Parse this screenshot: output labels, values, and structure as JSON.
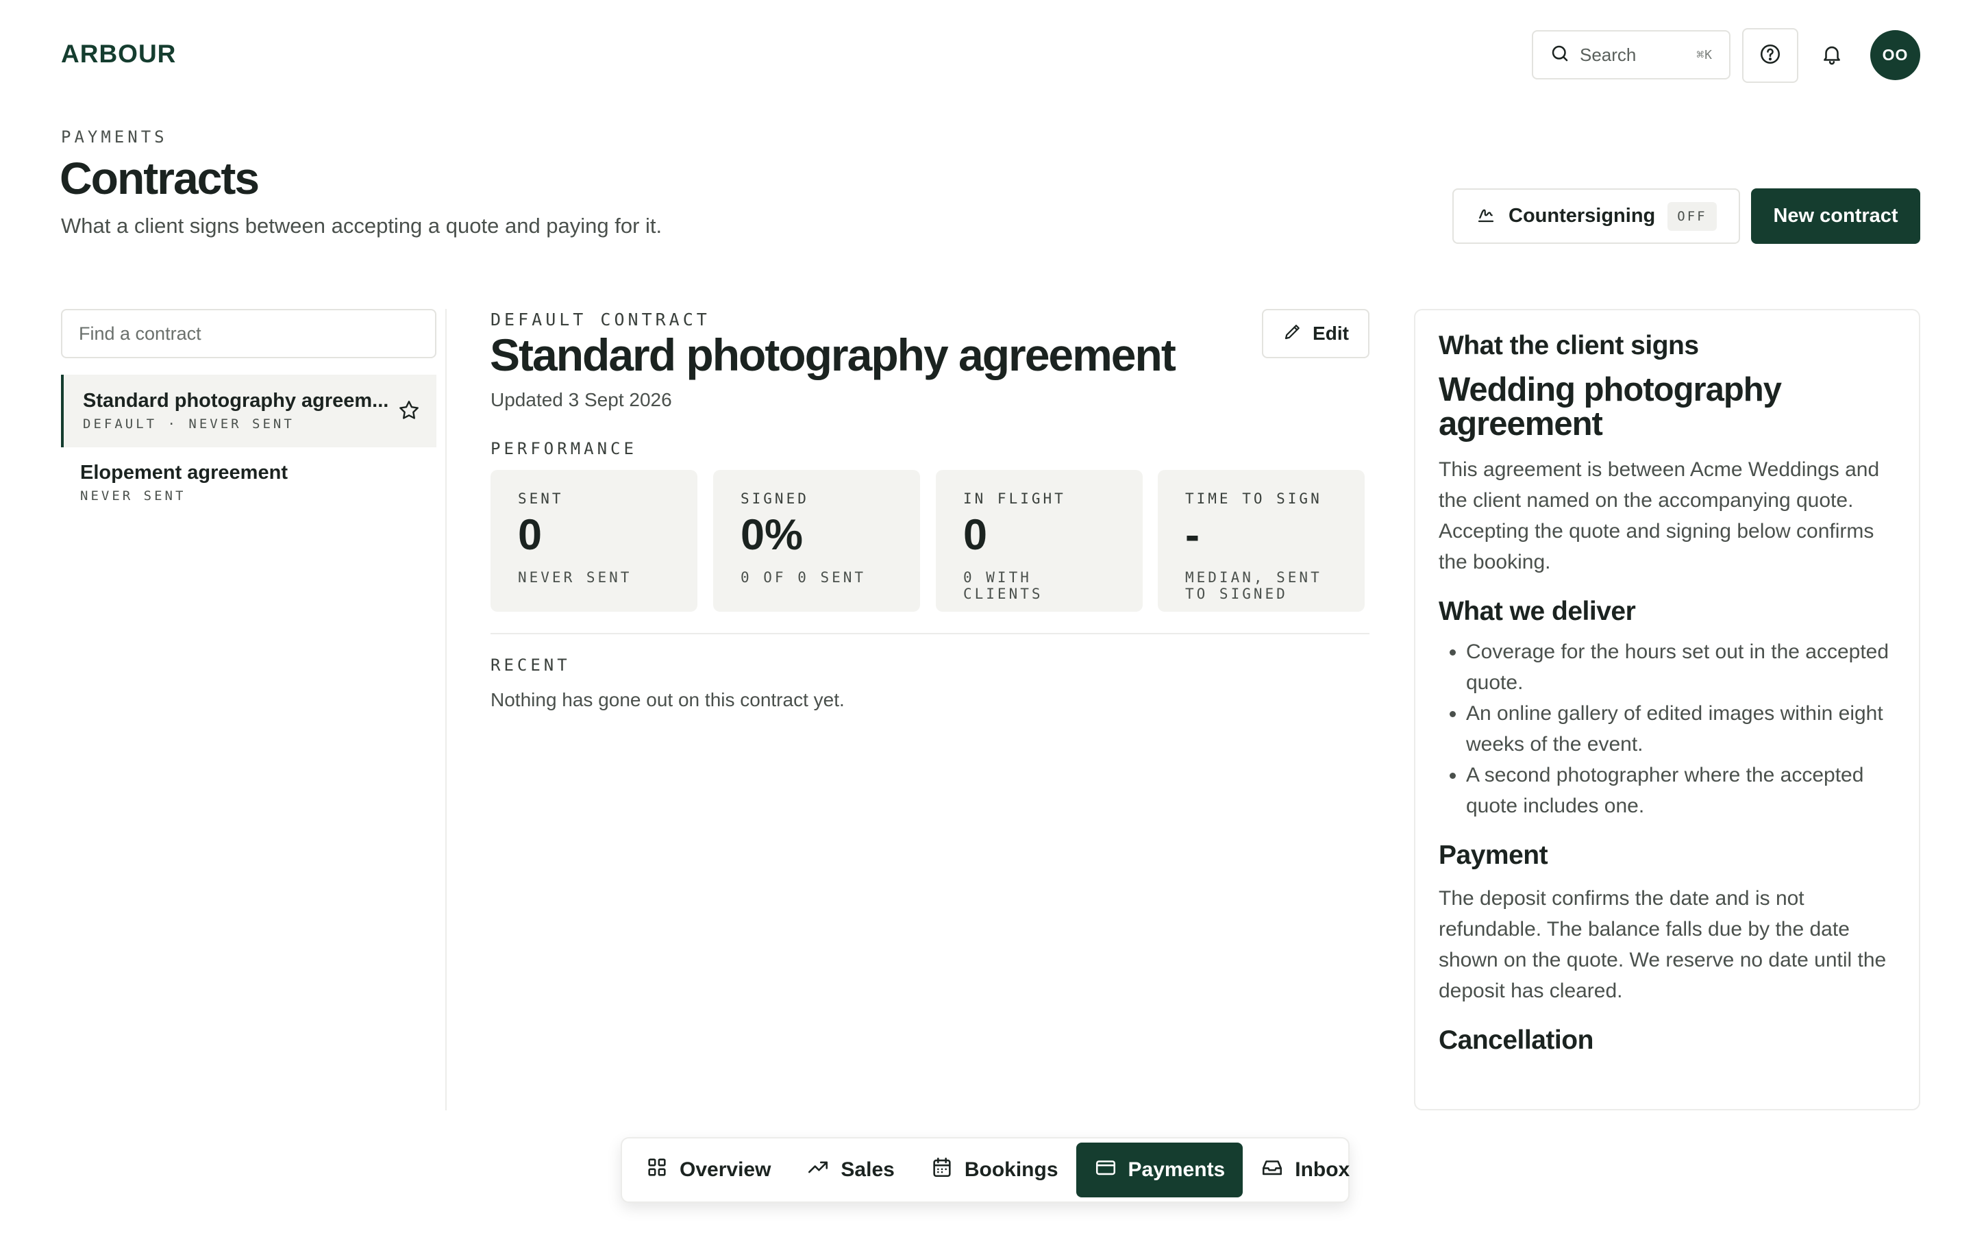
{
  "app": {
    "logo": "ARBOUR"
  },
  "topbar": {
    "search_label": "Search",
    "search_shortcut": "⌘K",
    "avatar_initials": "OO"
  },
  "page": {
    "eyebrow": "PAYMENTS",
    "title": "Contracts",
    "subtitle": "What a client signs between accepting a quote and paying for it.",
    "countersigning_label": "Countersigning",
    "countersigning_state": "OFF",
    "new_contract_label": "New contract"
  },
  "sidebar": {
    "find_placeholder": "Find a contract",
    "items": [
      {
        "title": "Standard photography agreem...",
        "meta": "DEFAULT · NEVER SENT",
        "active": true
      },
      {
        "title": "Elopement agreement",
        "meta": "NEVER SENT",
        "active": false
      }
    ]
  },
  "contract": {
    "eyebrow": "DEFAULT CONTRACT",
    "title": "Standard photography agreement",
    "updated": "Updated 3 Sept 2026",
    "edit_label": "Edit",
    "performance_label": "PERFORMANCE",
    "stats": [
      {
        "label": "SENT",
        "value": "0",
        "sub": "NEVER SENT"
      },
      {
        "label": "SIGNED",
        "value": "0%",
        "sub": "0 OF 0 SENT"
      },
      {
        "label": "IN FLIGHT",
        "value": "0",
        "sub": "0 WITH CLIENTS"
      },
      {
        "label": "TIME TO SIGN",
        "value": "-",
        "sub": "MEDIAN, SENT TO SIGNED"
      }
    ],
    "recent_label": "RECENT",
    "recent_empty": "Nothing has gone out on this contract yet."
  },
  "preview": {
    "heading": "What the client signs",
    "doc_title": "Wedding photography agreement",
    "intro": "This agreement is between Acme Weddings and the client named on the accompanying quote. Accepting the quote and signing below confirms the booking.",
    "deliver_heading": "What we deliver",
    "deliver_items": [
      "Coverage for the hours set out in the accepted quote.",
      "An online gallery of edited images within eight weeks of the event.",
      "A second photographer where the accepted quote includes one."
    ],
    "payment_heading": "Payment",
    "payment_text": "The deposit confirms the date and is not refundable. The balance falls due by the date shown on the quote. We reserve no date until the deposit has cleared.",
    "cancellation_heading": "Cancellation"
  },
  "bottom_nav": {
    "items": [
      {
        "label": "Overview",
        "icon": "grid-icon"
      },
      {
        "label": "Sales",
        "icon": "trend-up-icon"
      },
      {
        "label": "Bookings",
        "icon": "calendar-icon"
      },
      {
        "label": "Payments",
        "icon": "card-icon",
        "active": true
      },
      {
        "label": "Inbox",
        "icon": "inbox-icon"
      }
    ]
  },
  "colors": {
    "brand": "#153d2f",
    "surface": "#f3f3f0",
    "border": "#e3e3df"
  }
}
